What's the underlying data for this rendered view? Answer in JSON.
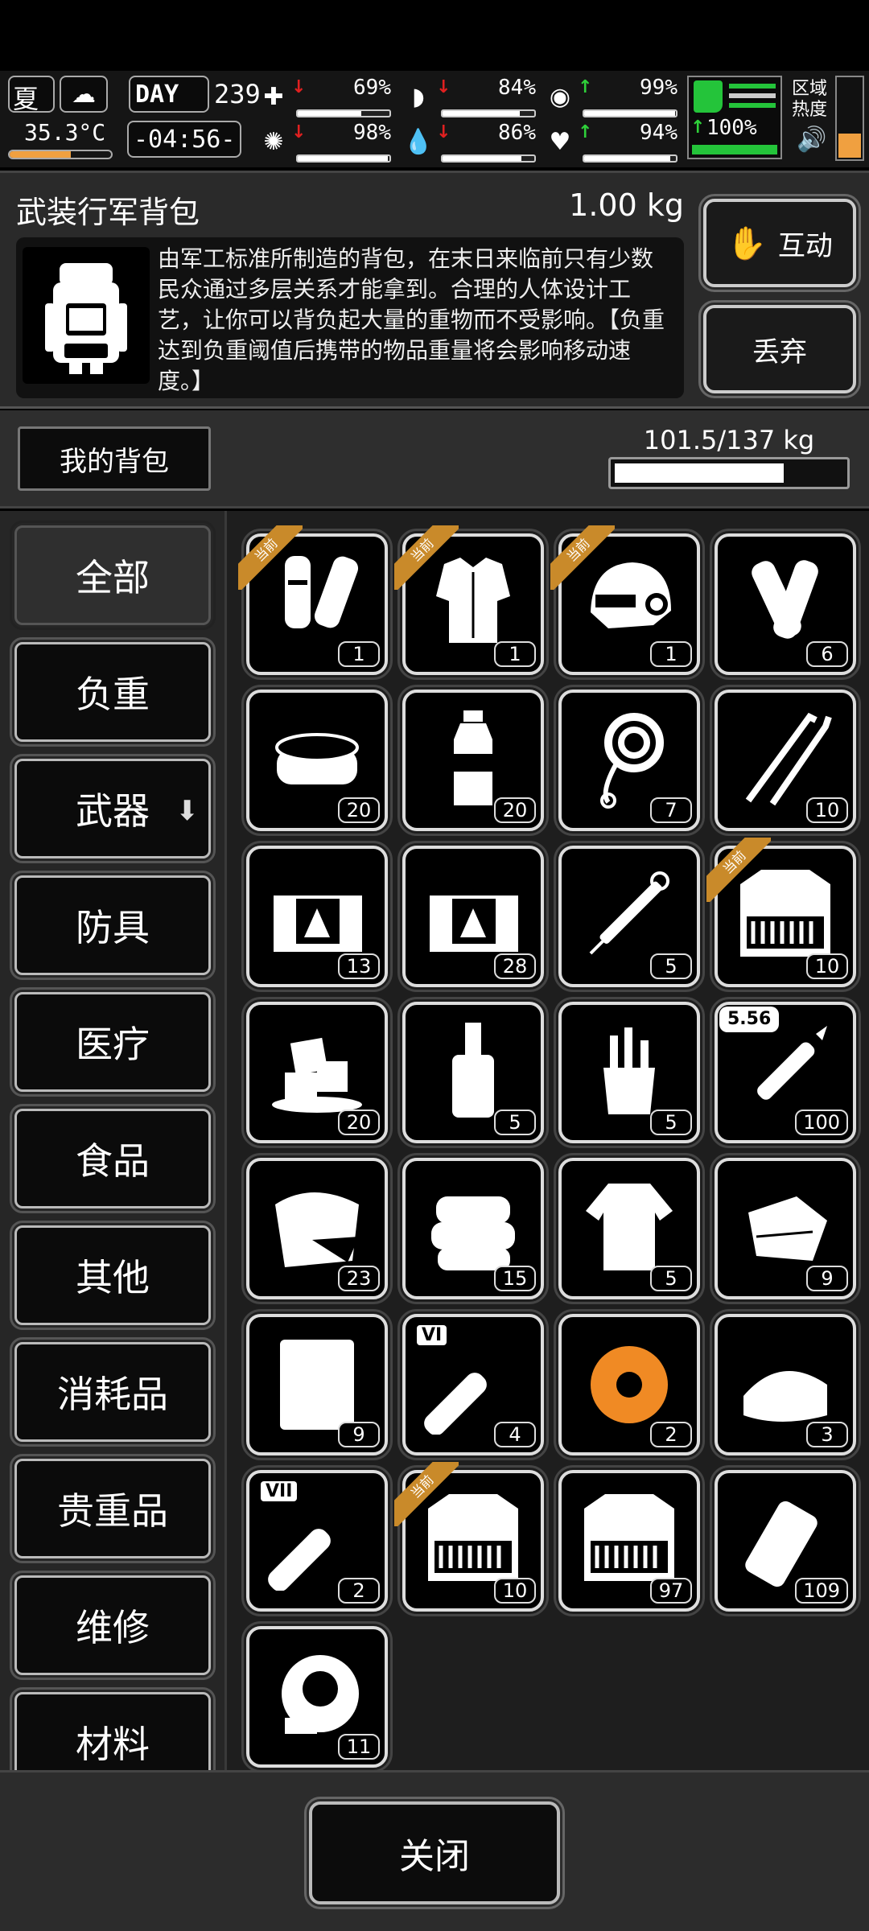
{
  "hud": {
    "season": "夏",
    "day_label": "DAY",
    "day": "239",
    "temperature": "35.3°C",
    "time": "-04:56-",
    "zone_heat_label": "区域\n热度",
    "stats": [
      {
        "icon": "medkit-icon",
        "trend": "down",
        "value": "69%",
        "fill": 0.69
      },
      {
        "icon": "stomach-icon",
        "trend": "down",
        "value": "84%",
        "fill": 0.84
      },
      {
        "icon": "bladder-icon",
        "trend": "up",
        "value": "99%",
        "fill": 0.99
      },
      {
        "icon": "brain-icon",
        "trend": "down",
        "value": "98%",
        "fill": 0.98
      },
      {
        "icon": "water-drop-icon",
        "trend": "down",
        "value": "86%",
        "fill": 0.86
      },
      {
        "icon": "heart-icon",
        "trend": "up",
        "value": "94%",
        "fill": 0.94
      }
    ],
    "stamina": {
      "value": "100%",
      "fill": 1.0
    }
  },
  "item": {
    "title": "武装行军背包",
    "weight": "1.00 kg",
    "description": "由军工标准所制造的背包，在末日来临前只有少数民众通过多层关系才能拿到。合理的人体设计工艺，让你可以背负起大量的重物而不受影响。【负重达到负重阈值后携带的物品重量将会影响移动速度。】",
    "interact_label": "互动",
    "discard_label": "丢弃"
  },
  "backpack": {
    "tab_label": "我的背包",
    "weight_text": "101.5/137 kg",
    "fill": 0.741
  },
  "categories": [
    {
      "label": "全部",
      "active": true
    },
    {
      "label": "负重"
    },
    {
      "label": "武器",
      "dropdown": true
    },
    {
      "label": "防具"
    },
    {
      "label": "医疗"
    },
    {
      "label": "食品"
    },
    {
      "label": "其他"
    },
    {
      "label": "消耗品"
    },
    {
      "label": "贵重品"
    },
    {
      "label": "维修"
    },
    {
      "label": "材料"
    }
  ],
  "equipped_tag": "当前",
  "items": [
    {
      "name": "leg-guards",
      "qty": "1",
      "equipped": true
    },
    {
      "name": "body-armor",
      "qty": "1",
      "equipped": true
    },
    {
      "name": "tactical-helmet",
      "qty": "1",
      "equipped": true
    },
    {
      "name": "paper-rolls",
      "qty": "6"
    },
    {
      "name": "canned-food",
      "qty": "20"
    },
    {
      "name": "water-bottle",
      "qty": "20"
    },
    {
      "name": "rope",
      "qty": "7"
    },
    {
      "name": "lockpicks",
      "qty": "10"
    },
    {
      "name": "supply-crate",
      "qty": "13"
    },
    {
      "name": "supply-crate",
      "qty": "28"
    },
    {
      "name": "syringe",
      "qty": "5"
    },
    {
      "name": "ammo-box",
      "qty": "10",
      "equipped": true
    },
    {
      "name": "ice-cubes",
      "qty": "20"
    },
    {
      "name": "liquor-bottle",
      "qty": "5"
    },
    {
      "name": "tool-bucket",
      "qty": "5"
    },
    {
      "name": "rifle-bullet",
      "qty": "100",
      "caliber": "5.56"
    },
    {
      "name": "cloth-sack",
      "qty": "23"
    },
    {
      "name": "folded-towels",
      "qty": "15"
    },
    {
      "name": "torn-shirt",
      "qty": "5"
    },
    {
      "name": "cloth-pieces",
      "qty": "9"
    },
    {
      "name": "paper-sheet",
      "qty": "9"
    },
    {
      "name": "test-tube-vi",
      "qty": "4",
      "tube_label": "VI"
    },
    {
      "name": "orange-tape",
      "qty": "2",
      "highlight": "#f08a24"
    },
    {
      "name": "folded-cloth",
      "qty": "3"
    },
    {
      "name": "test-tube-vii",
      "qty": "2",
      "tube_label": "VII"
    },
    {
      "name": "ammo-box",
      "qty": "10",
      "equipped": true
    },
    {
      "name": "ammo-box",
      "qty": "97"
    },
    {
      "name": "pouch",
      "qty": "109"
    },
    {
      "name": "duct-tape",
      "qty": "11"
    }
  ],
  "close_label": "关闭",
  "colors": {
    "accent": "#c98a2a",
    "up": "#2fd13a",
    "down": "#e02020",
    "stamina": "#24c43a",
    "heat": "#f0a040"
  }
}
